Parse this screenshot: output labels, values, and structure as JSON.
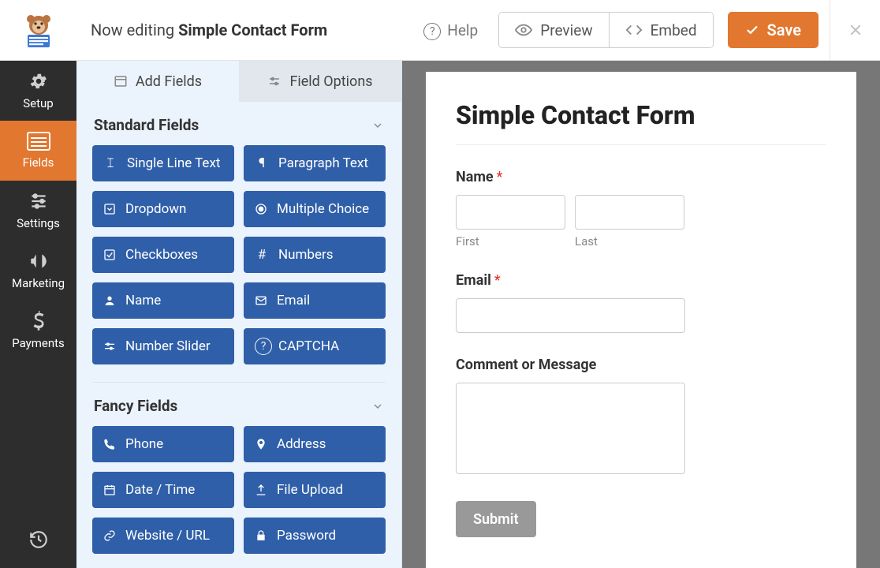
{
  "header": {
    "editing_prefix": "Now editing ",
    "form_name": "Simple Contact Form",
    "help": "Help",
    "preview": "Preview",
    "embed": "Embed",
    "save": "Save"
  },
  "nav": {
    "setup": "Setup",
    "fields": "Fields",
    "settings": "Settings",
    "marketing": "Marketing",
    "payments": "Payments"
  },
  "panel": {
    "tabs": {
      "add": "Add Fields",
      "options": "Field Options"
    },
    "groups": {
      "standard": {
        "title": "Standard Fields",
        "items": [
          "Single Line Text",
          "Paragraph Text",
          "Dropdown",
          "Multiple Choice",
          "Checkboxes",
          "Numbers",
          "Name",
          "Email",
          "Number Slider",
          "CAPTCHA"
        ]
      },
      "fancy": {
        "title": "Fancy Fields",
        "items": [
          "Phone",
          "Address",
          "Date / Time",
          "File Upload",
          "Website / URL",
          "Password"
        ]
      }
    }
  },
  "form": {
    "title": "Simple Contact Form",
    "name_label": "Name",
    "first": "First",
    "last": "Last",
    "email_label": "Email",
    "comment_label": "Comment or Message",
    "submit": "Submit"
  }
}
